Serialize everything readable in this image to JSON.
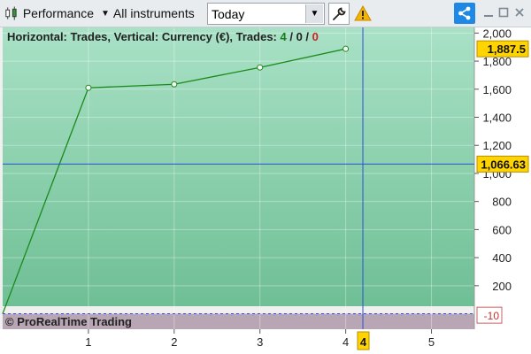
{
  "toolbar": {
    "performance_label": "Performance",
    "instruments_label": "All instruments",
    "period_value": "Today",
    "caret": "▼"
  },
  "header": {
    "prefix": "Horizontal: Trades, Vertical: Currency (€), Trades: ",
    "winning": "4",
    "neutral": "0",
    "losing": "0",
    "sep": " / "
  },
  "footer": {
    "brand": "© ProRealTime Trading"
  },
  "colors": {
    "plot_top": "#a9e1c6",
    "plot_bottom": "#6fbf95",
    "negative_band": "#b8a6b5",
    "line": "#1a8a1a",
    "crosshair": "#2b4fd8",
    "label_yellow": "#ffd400"
  },
  "chart_data": {
    "type": "line",
    "x": [
      0,
      1,
      2,
      3,
      4
    ],
    "series": [
      {
        "values": [
          0,
          1610,
          1635,
          1755,
          1887.5
        ]
      }
    ],
    "xlim": [
      0,
      5.5
    ],
    "ylim": [
      -110,
      2040
    ],
    "y_ticks": [
      "2,000",
      "1,800",
      "1,600",
      "1,400",
      "1,200",
      "1,000",
      "800",
      "600",
      "400",
      "200"
    ],
    "y_tick_values": [
      2000,
      1800,
      1600,
      1400,
      1200,
      1000,
      800,
      600,
      400,
      200
    ],
    "x_ticks": [
      "1",
      "2",
      "3",
      "4",
      "5"
    ],
    "x_tick_values": [
      1,
      2,
      3,
      4,
      5
    ],
    "last_value_label": "1,887.5",
    "last_value": 1887.5,
    "cursor_value_label": "1,066.63",
    "cursor_value": 1066.63,
    "cursor_x_label": "4",
    "cursor_x": 4.2,
    "negative_label": "-10",
    "negative_value": -10,
    "grid": true
  }
}
